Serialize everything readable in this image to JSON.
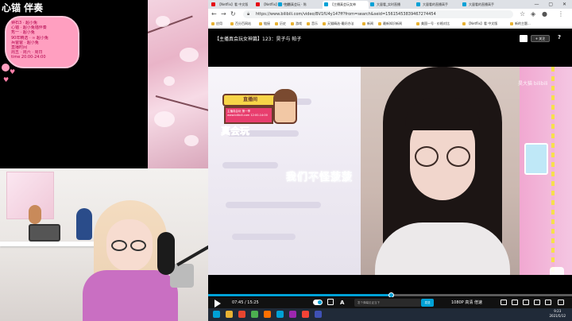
{
  "overlay": {
    "title": "心锚 伴奏",
    "bubble_lines": [
      "钟石3 · 超小兔",
      "心锚 · 超小兔锚伴奏",
      "秀一  · 超小兔",
      "90年精选 · ∞ 超小兔",
      "兵爸爸 · 超小兔",
      "直播时间",
      "周五 · 周六 · 周日",
      "time 20:00-24:00"
    ]
  },
  "browser": {
    "tabs": [
      {
        "label": "【Netflix】看 中文版",
        "color": "#e50914"
      },
      {
        "label": "【Netflix】看 中文",
        "color": "#e50914"
      },
      {
        "label": "主播真会玩 · 陈",
        "color": "#00a1d6"
      },
      {
        "label": "【主播真会玩女神",
        "color": "#00a1d6"
      },
      {
        "label": "大量看_实时直播",
        "color": "#00a1d6"
      },
      {
        "label": "大量看的直播高手",
        "color": "#00a1d6"
      },
      {
        "label": "大量看的直播高手",
        "color": "#00a1d6"
      }
    ],
    "url": "https://www.bilibili.com/video/BV1fU4y147ff?from=search&seid=15615453839467274454",
    "bookmarks": [
      "应用",
      "百分百网站",
      "链接",
      "历史",
      "游戏",
      "音乐",
      "天猫精选-最好办法",
      "新闻",
      "最新知识新闻",
      "美国一号 · 价格对比",
      "【Netflix】看 中文版",
      "新的主题..."
    ],
    "window_controls": "— ▢ ✕"
  },
  "player": {
    "title": "【主播真会玩女神篇】123：昊子与 帕子",
    "follow_label": "+ 关注",
    "help_label": "?",
    "caption": "我们不怪菠菠",
    "watermark": "昊大猫 bilibili",
    "current_time": "07:45",
    "total_time": "15:25",
    "progress_ratio": 0.503,
    "danmaku_placeholder": "发个弹幕见证当下",
    "danmaku_send": "发送",
    "quality": "1080P 高清",
    "speed": "倍速",
    "logo": {
      "banner": "直播间",
      "screen_text": "主播真会玩 第一季\nwww.bilibili.com\n12:00-14:00",
      "text": "真会玩"
    }
  },
  "taskbar": {
    "time": "9:23",
    "date": "2021/5/12",
    "icons": [
      "#00a1d6",
      "#e8b233",
      "#e8452f",
      "#4caf50",
      "#ff6f00",
      "#00a1d6",
      "#9c27b0",
      "#f44336",
      "#3f51b5"
    ]
  }
}
